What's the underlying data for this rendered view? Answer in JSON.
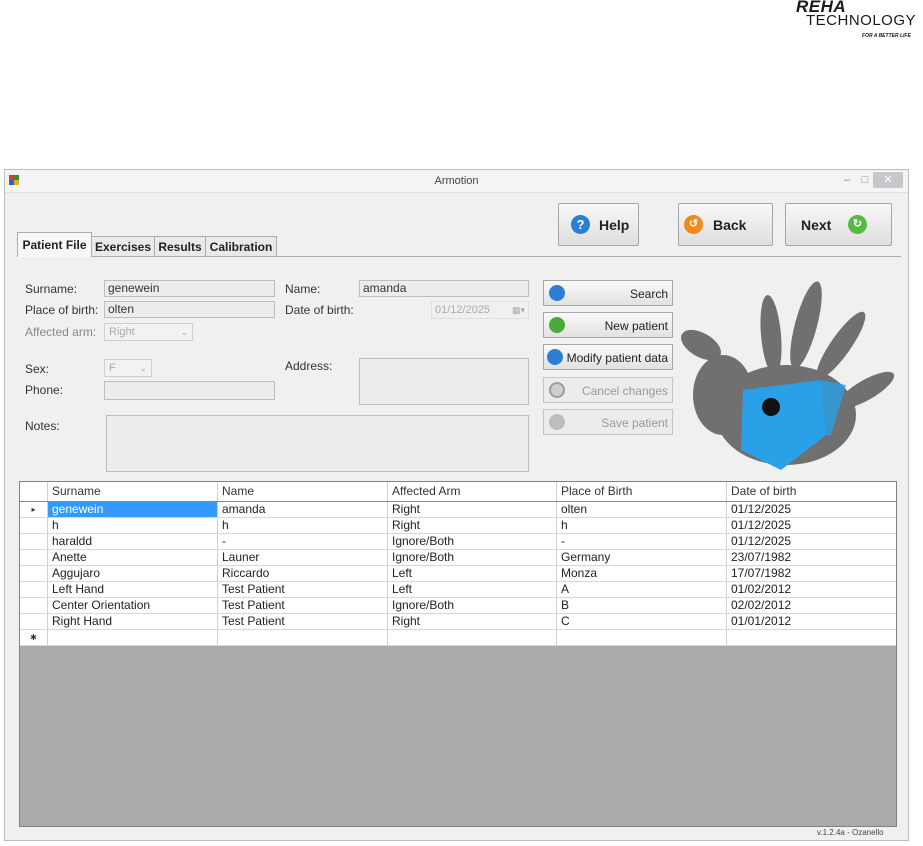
{
  "logo": {
    "line1": "REHA",
    "line2": "TECHNOLOGY",
    "tagline": "FOR A BETTER LIFE"
  },
  "window": {
    "title": "Armotion",
    "minimize": "–",
    "maximize": "□",
    "close": "✕"
  },
  "buttons": {
    "help": "Help",
    "back": "Back",
    "next": "Next"
  },
  "tabs": [
    "Patient File",
    "Exercises",
    "Results",
    "Calibration"
  ],
  "form": {
    "surname_label": "Surname:",
    "surname_value": "genewein",
    "place_label": "Place of birth:",
    "place_value": "olten",
    "arm_label": "Affected arm:",
    "arm_value": "Right",
    "sex_label": "Sex:",
    "sex_value": "F",
    "phone_label": "Phone:",
    "phone_value": "",
    "notes_label": "Notes:",
    "notes_value": "",
    "name_label": "Name:",
    "name_value": "amanda",
    "dob_label": "Date of birth:",
    "dob_value": "01/12/2025",
    "address_label": "Address:",
    "address_value": ""
  },
  "actions": {
    "search": "Search",
    "new_patient": "New patient",
    "modify": "Modify patient data",
    "cancel": "Cancel changes",
    "save": "Save patient"
  },
  "grid": {
    "columns": [
      "Surname",
      "Name",
      "Affected Arm",
      "Place of Birth",
      "Date of birth"
    ],
    "rows": [
      [
        "genewein",
        "amanda",
        "Right",
        "olten",
        "01/12/2025"
      ],
      [
        "h",
        "h",
        "Right",
        "h",
        "01/12/2025"
      ],
      [
        "haraldd",
        "-",
        "Ignore/Both",
        "-",
        "01/12/2025"
      ],
      [
        "Anette",
        "Launer",
        "Ignore/Both",
        "Germany",
        "23/07/1982"
      ],
      [
        "Aggujaro",
        "Riccardo",
        "Left",
        "Monza",
        "17/07/1982"
      ],
      [
        "Left Hand",
        "Test Patient",
        "Left",
        "A",
        "01/02/2012"
      ],
      [
        "Center Orientation",
        "Test Patient",
        "Ignore/Both",
        "B",
        "02/02/2012"
      ],
      [
        "Right Hand",
        "Test Patient",
        "Right",
        "C",
        "01/01/2012"
      ]
    ],
    "current_row_marker": "▸",
    "new_row_marker": "✱"
  },
  "version": "v.1.2.4a - Ozanello",
  "colors": {
    "selection": "#3399ff",
    "help_icon": "#2a7fd4",
    "back_icon": "#f08a1c",
    "next_icon": "#57b947",
    "hand_accent": "#2aa0e6"
  }
}
